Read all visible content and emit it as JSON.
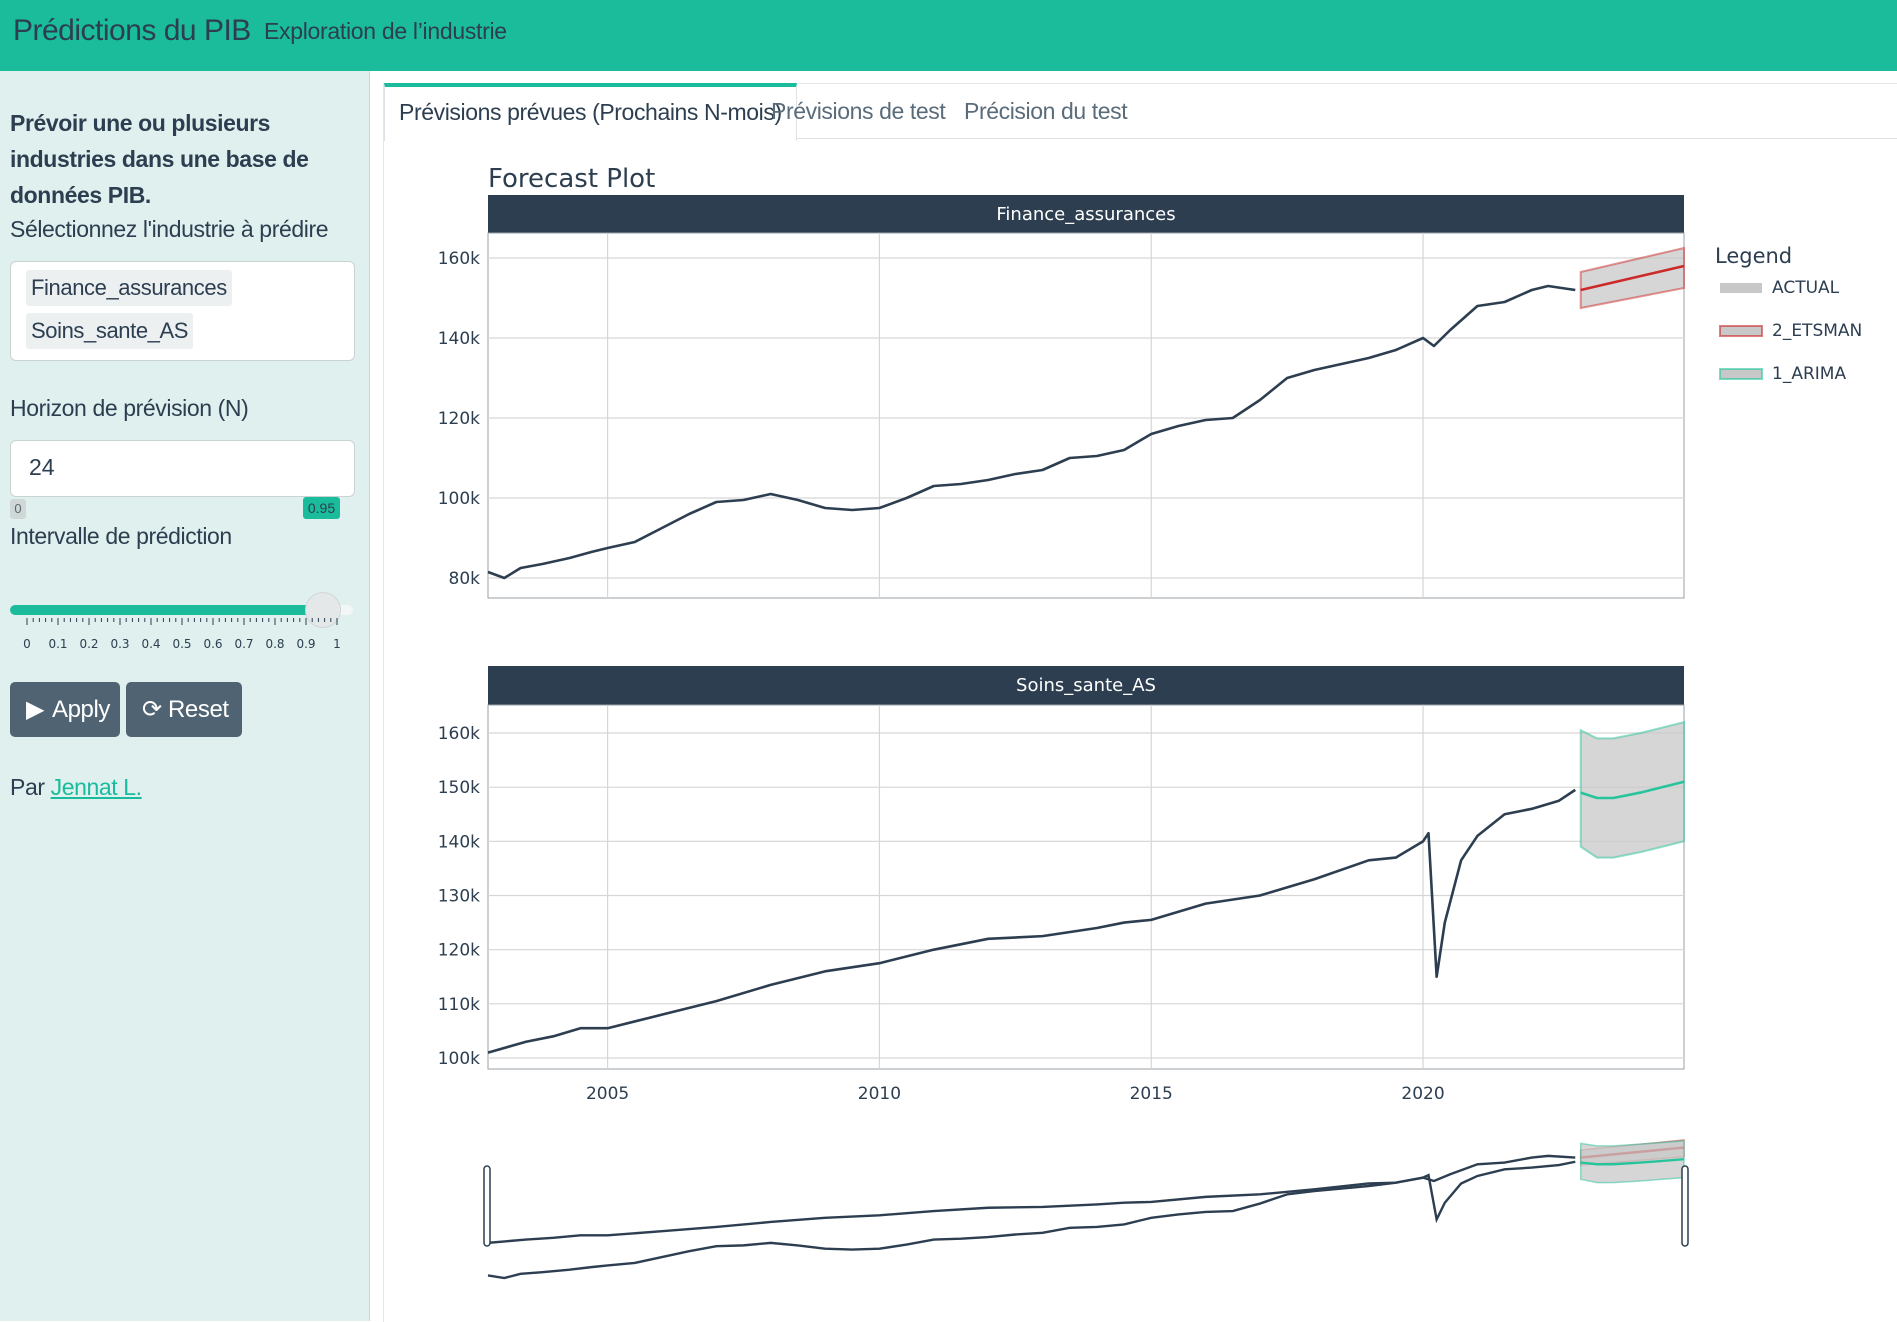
{
  "navbar": {
    "brand": "Prédictions du PIB",
    "link": "Exploration de l’industrie"
  },
  "sidebar": {
    "description": "Prévoir une ou plusieurs industries dans une base de données PIB.",
    "industry_label": "Sélectionnez l'industrie à prédire",
    "selected_industries": [
      "Finance_assurances",
      "Soins_sante_AS"
    ],
    "horizon_label": "Horizon de prévision (N)",
    "horizon_value": "24",
    "interval_label": "Intervalle de prédiction",
    "slider": {
      "min_label": "0",
      "value_label": "0.95",
      "value": 0.95,
      "ticks": [
        "0",
        "0.1",
        "0.2",
        "0.3",
        "0.4",
        "0.5",
        "0.6",
        "0.7",
        "0.8",
        "0.9",
        "1"
      ]
    },
    "apply_label": "Apply",
    "reset_label": "Reset",
    "credit_prefix": "Par",
    "credit_link": "Jennat L."
  },
  "tabs": [
    {
      "label": "Prévisions prévues (Prochains N-mois)",
      "active": true
    },
    {
      "label": "Prévisions de test",
      "active": false
    },
    {
      "label": "Précision du test",
      "active": false
    }
  ],
  "colors": {
    "accent": "#1abc9c",
    "actual": "#2c3e50",
    "etsman": "#cc2a2a",
    "arima": "#27c49c",
    "band": "#c8c8c8",
    "strip": "#2c3e50"
  },
  "chart_data": {
    "type": "line",
    "title": "Forecast Plot",
    "legend": {
      "title": "Legend",
      "placement": "right",
      "entries": [
        "ACTUAL",
        "2_ETSMAN",
        "1_ARIMA"
      ]
    },
    "x_ticks": [
      "2005",
      "2010",
      "2015",
      "2020"
    ],
    "xlim": [
      2002.8,
      2024.8
    ],
    "panels": [
      {
        "strip": "Finance_assurances",
        "y_ticks": [
          "160k",
          "140k",
          "120k",
          "100k",
          "80k"
        ],
        "ylim": [
          75000,
          168000
        ],
        "series": [
          {
            "name": "ACTUAL",
            "x": [
              2002.8,
              2003.1,
              2003.4,
              2003.8,
              2004.3,
              2004.7,
              2005.0,
              2005.5,
              2006.0,
              2006.5,
              2007.0,
              2007.5,
              2008.0,
              2008.5,
              2009.0,
              2009.5,
              2010.0,
              2010.5,
              2011.0,
              2011.5,
              2012.0,
              2012.5,
              2013.0,
              2013.5,
              2014.0,
              2014.5,
              2015.0,
              2015.5,
              2016.0,
              2016.5,
              2017.0,
              2017.5,
              2018.0,
              2018.5,
              2019.0,
              2019.5,
              2020.0,
              2020.2,
              2020.5,
              2021.0,
              2021.5,
              2022.0,
              2022.3,
              2022.8
            ],
            "y": [
              81500,
              80000,
              82500,
              83500,
              85000,
              86500,
              87500,
              89000,
              92500,
              96000,
              99000,
              99500,
              101000,
              99500,
              97500,
              97000,
              97500,
              100000,
              103000,
              103500,
              104500,
              106000,
              107000,
              110000,
              110500,
              112000,
              116000,
              118000,
              119500,
              120000,
              124500,
              130000,
              132000,
              133500,
              135000,
              137000,
              140000,
              138000,
              142000,
              148000,
              149000,
              152000,
              153000,
              152000
            ]
          },
          {
            "name": "2_ETSMAN",
            "x": [
              2022.9,
              2024.8
            ],
            "y": [
              152000,
              158000
            ],
            "lo": [
              147500,
              152500
            ],
            "hi": [
              156500,
              162500
            ]
          }
        ]
      },
      {
        "strip": "Soins_sante_AS",
        "y_ticks": [
          "160k",
          "150k",
          "140k",
          "130k",
          "120k",
          "110k",
          "100k"
        ],
        "ylim": [
          98000,
          165000
        ],
        "series": [
          {
            "name": "ACTUAL",
            "x": [
              2002.8,
              2003.5,
              2004.0,
              2004.5,
              2005.0,
              2006.0,
              2007.0,
              2008.0,
              2009.0,
              2010.0,
              2011.0,
              2012.0,
              2013.0,
              2014.0,
              2014.5,
              2015.0,
              2016.0,
              2017.0,
              2018.0,
              2019.0,
              2019.5,
              2020.0,
              2020.1,
              2020.25,
              2020.4,
              2020.7,
              2021.0,
              2021.5,
              2022.0,
              2022.5,
              2022.8
            ],
            "y": [
              101000,
              103000,
              104000,
              105500,
              105500,
              108000,
              110500,
              113500,
              116000,
              117500,
              120000,
              122000,
              122500,
              124000,
              125000,
              125500,
              128500,
              130000,
              133000,
              136500,
              137000,
              140000,
              141500,
              115000,
              125000,
              136500,
              141000,
              145000,
              146000,
              147500,
              149500
            ]
          },
          {
            "name": "1_ARIMA",
            "x": [
              2022.9,
              2023.2,
              2023.5,
              2024.0,
              2024.8
            ],
            "y": [
              149000,
              148000,
              148000,
              149000,
              151000
            ],
            "lo": [
              139000,
              137000,
              137000,
              138000,
              140000
            ],
            "hi": [
              160500,
              159000,
              159000,
              160000,
              162000
            ]
          }
        ]
      }
    ],
    "rangeslider": true
  }
}
